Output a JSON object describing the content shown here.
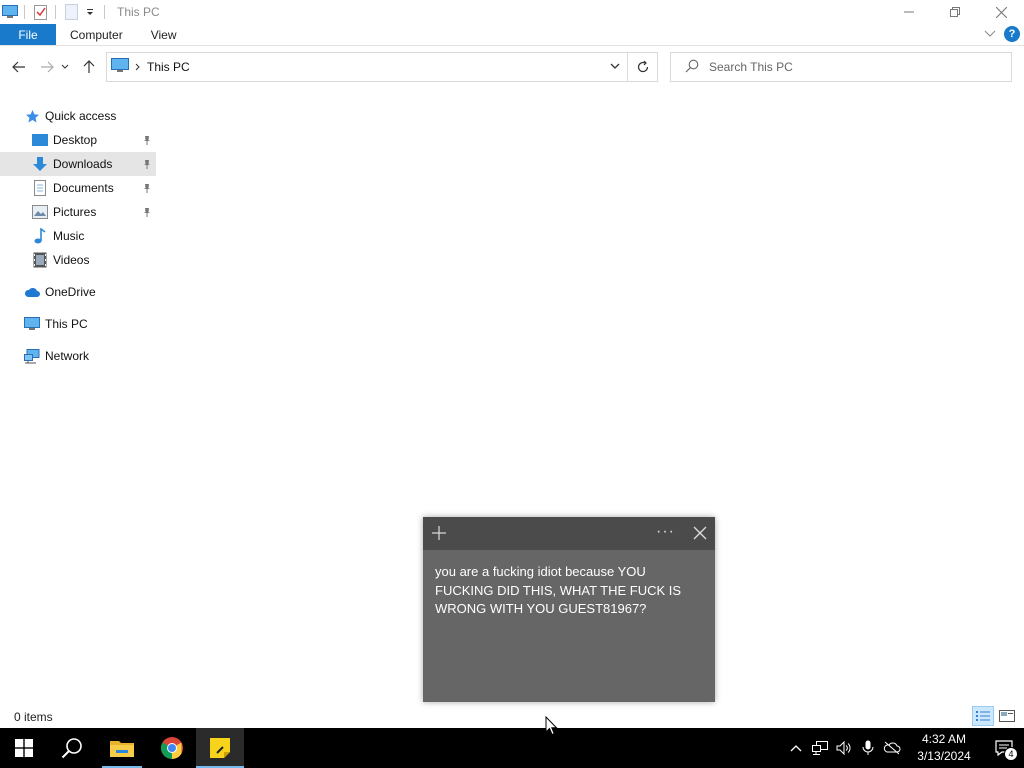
{
  "window": {
    "title": "This PC"
  },
  "ribbon": {
    "tabs": [
      "File",
      "Computer",
      "View"
    ]
  },
  "address": {
    "crumb": "This PC",
    "search_placeholder": "Search This PC"
  },
  "nav": {
    "quick_access": "Quick access",
    "items": [
      {
        "label": "Desktop",
        "icon": "desktop-icon",
        "pinned": true
      },
      {
        "label": "Downloads",
        "icon": "downloads-icon",
        "pinned": true,
        "selected": true
      },
      {
        "label": "Documents",
        "icon": "documents-icon",
        "pinned": true
      },
      {
        "label": "Pictures",
        "icon": "pictures-icon",
        "pinned": true
      },
      {
        "label": "Music",
        "icon": "music-icon",
        "pinned": false
      },
      {
        "label": "Videos",
        "icon": "videos-icon",
        "pinned": false
      }
    ],
    "onedrive": "OneDrive",
    "this_pc": "This PC",
    "network": "Network"
  },
  "status": {
    "items_count": "0 items"
  },
  "sticky_note": {
    "text": "you are a fucking idiot because YOU FUCKING DID THIS, WHAT THE FUCK IS WRONG WITH YOU GUEST81967?"
  },
  "taskbar": {
    "apps": [
      "start",
      "search",
      "file-explorer",
      "chrome",
      "sticky-notes"
    ]
  },
  "clock": {
    "time": "4:32 AM",
    "date": "3/13/2024"
  },
  "notifications": {
    "count": "4"
  },
  "colors": {
    "accent": "#1979ca",
    "selection": "#e5e5e5",
    "sticky_body": "#666666",
    "sticky_header": "#4b4b4b",
    "taskbar": "#000000"
  }
}
